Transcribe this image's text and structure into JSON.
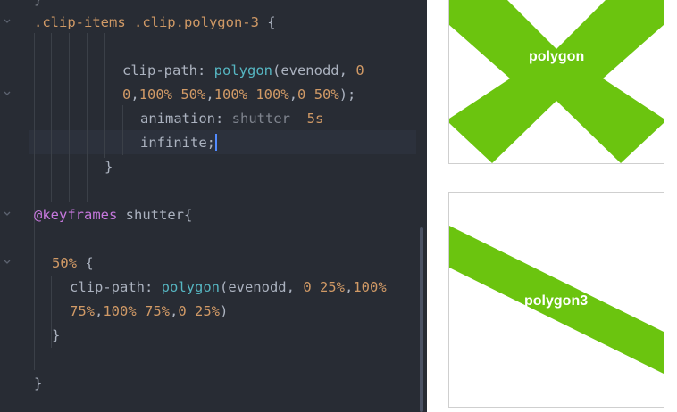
{
  "editor": {
    "lines": [
      {
        "tokens": [
          {
            "c": "t-dim",
            "t": "}"
          }
        ]
      },
      {
        "tokens": [
          {
            "c": "t-sel",
            "t": ".clip-items .clip.polygon-3 "
          },
          {
            "c": "t-prop",
            "t": "{"
          }
        ]
      },
      {
        "tokens": []
      },
      {
        "tokens": [
          {
            "c": "t-prop",
            "t": "clip-path: "
          },
          {
            "c": "t-fn",
            "t": "polygon"
          },
          {
            "c": "t-prop",
            "t": "(evenodd, "
          },
          {
            "c": "t-num",
            "t": "0"
          }
        ]
      },
      {
        "tokens": [
          {
            "c": "t-num",
            "t": "0"
          },
          {
            "c": "t-prop",
            "t": ","
          },
          {
            "c": "t-num",
            "t": "100% 50%"
          },
          {
            "c": "t-prop",
            "t": ","
          },
          {
            "c": "t-num",
            "t": "100% 100%"
          },
          {
            "c": "t-prop",
            "t": ","
          },
          {
            "c": "t-num",
            "t": "0 50%"
          },
          {
            "c": "t-prop",
            "t": ");"
          }
        ]
      },
      {
        "tokens": [
          {
            "c": "t-prop",
            "t": "animation: "
          },
          {
            "c": "t-dim",
            "t": "shutter  "
          },
          {
            "c": "t-num",
            "t": "5s"
          }
        ]
      },
      {
        "tokens": [
          {
            "c": "t-prop",
            "t": "infinite;"
          }
        ],
        "cursor": true
      },
      {
        "tokens": [
          {
            "c": "t-prop",
            "t": "}"
          }
        ]
      },
      {
        "tokens": []
      },
      {
        "tokens": [
          {
            "c": "t-kw",
            "t": "@keyframes"
          },
          {
            "c": "t-prop",
            "t": " shutter{"
          }
        ]
      },
      {
        "tokens": []
      },
      {
        "tokens": [
          {
            "c": "t-num",
            "t": "50%"
          },
          {
            "c": "t-prop",
            "t": " {"
          }
        ]
      },
      {
        "tokens": [
          {
            "c": "t-prop",
            "t": "clip-path: "
          },
          {
            "c": "t-fn",
            "t": "polygon"
          },
          {
            "c": "t-prop",
            "t": "(evenodd, "
          },
          {
            "c": "t-num",
            "t": "0 25%"
          },
          {
            "c": "t-prop",
            "t": ","
          },
          {
            "c": "t-num",
            "t": "100%"
          }
        ]
      },
      {
        "tokens": [
          {
            "c": "t-num",
            "t": "75%"
          },
          {
            "c": "t-prop",
            "t": ","
          },
          {
            "c": "t-num",
            "t": "100% 75%"
          },
          {
            "c": "t-prop",
            "t": ","
          },
          {
            "c": "t-num",
            "t": "0 25%"
          },
          {
            "c": "t-prop",
            "t": ")"
          }
        ]
      },
      {
        "tokens": [
          {
            "c": "t-prop",
            "t": "}"
          }
        ]
      },
      {
        "tokens": []
      },
      {
        "tokens": [
          {
            "c": "t-prop",
            "t": "}"
          }
        ]
      }
    ],
    "fold_icons": [
      "chevron-down-icon",
      "chevron-down-icon",
      "chevron-down-icon",
      "chevron-down-icon"
    ]
  },
  "preview": {
    "shape_color": "#6bc40f",
    "card1_label": "polygon",
    "card2_label": "polygon3"
  }
}
